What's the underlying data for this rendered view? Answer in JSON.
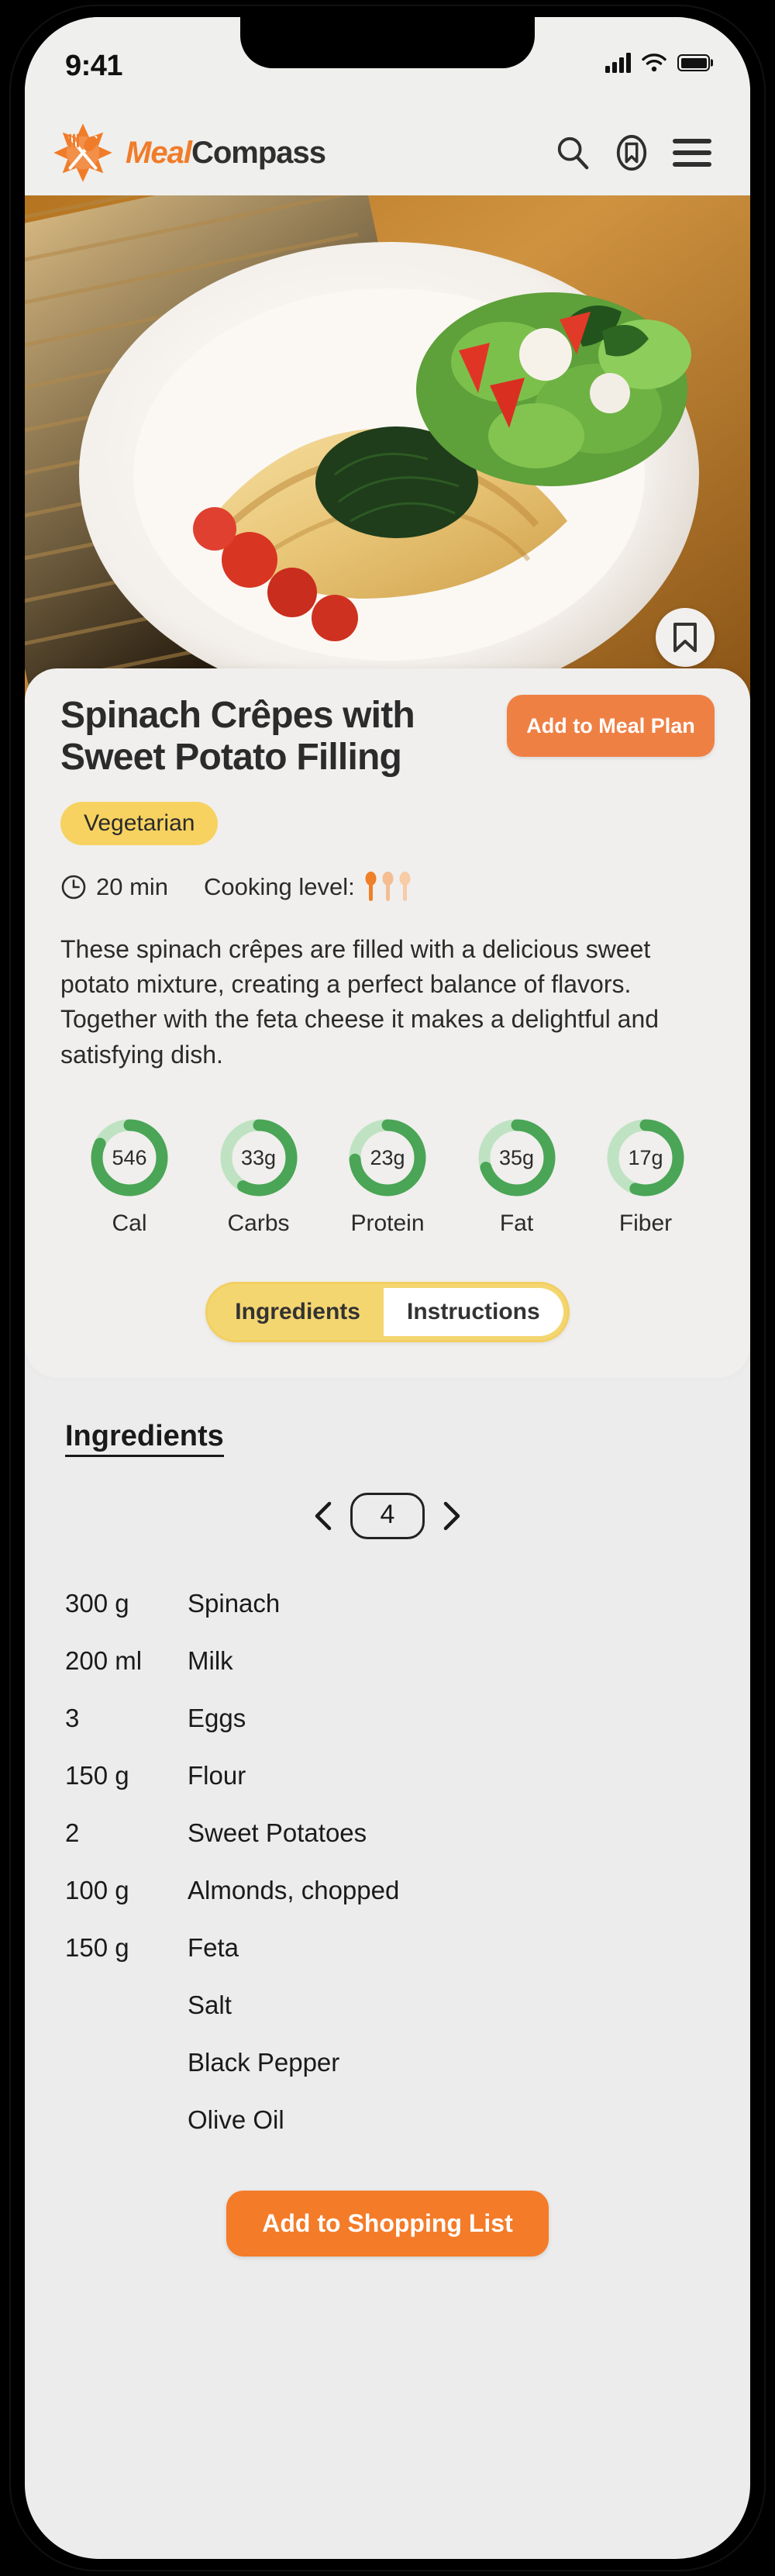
{
  "status_bar": {
    "time": "9:41",
    "signal_icon": "cellular-signal-icon",
    "wifi_icon": "wifi-icon",
    "battery_icon": "battery-full-icon"
  },
  "header": {
    "logo_icon": "meal-compass-logo-icon",
    "brand_part1": "Meal",
    "brand_part2": "Compass",
    "search_icon": "search-icon",
    "bookmark_icon": "bookmark-circle-icon",
    "menu_icon": "hamburger-menu-icon"
  },
  "hero": {
    "image_alt": "spinach crepes with salad on white plate",
    "bookmark_icon": "bookmark-icon"
  },
  "recipe": {
    "title": "Spinach Crêpes with Sweet Potato Filling",
    "add_to_meal_plan_label": "Add to Meal Plan",
    "diet_tag": "Vegetarian",
    "time_icon": "clock-icon",
    "time": "20 min",
    "cooking_level_label": "Cooking level:",
    "cooking_level_value": 1,
    "cooking_level_max": 3,
    "cooking_level_icon": "spoon-icon",
    "description": "These spinach crêpes are filled with a delicious sweet potato mixture, creating a perfect balance of flavors. Together with the feta cheese it makes a delightful and satisfying dish."
  },
  "nutrition": {
    "ring_color": "#4aa койка",
    "items": [
      {
        "value": "546",
        "label": "Cal",
        "percent": 82
      },
      {
        "value": "33g",
        "label": "Carbs",
        "percent": 58
      },
      {
        "value": "23g",
        "label": "Protein",
        "percent": 74
      },
      {
        "value": "35g",
        "label": "Fat",
        "percent": 70
      },
      {
        "value": "17g",
        "label": "Fiber",
        "percent": 55
      }
    ]
  },
  "tabs": {
    "items": [
      {
        "label": "Ingredients",
        "active": true
      },
      {
        "label": "Instructions",
        "active": false
      }
    ]
  },
  "ingredients_section": {
    "heading": "Ingredients",
    "servings": "4",
    "prev_icon": "chevron-left-icon",
    "next_icon": "chevron-right-icon",
    "rows": [
      {
        "qty": "300 g",
        "name": "Spinach"
      },
      {
        "qty": "200 ml",
        "name": "Milk"
      },
      {
        "qty": "3",
        "name": "Eggs"
      },
      {
        "qty": "150 g",
        "name": "Flour"
      },
      {
        "qty": "2",
        "name": "Sweet Potatoes"
      },
      {
        "qty": "100 g",
        "name": "Almonds, chopped"
      },
      {
        "qty": "150 g",
        "name": "Feta"
      },
      {
        "qty": "",
        "name": "Salt"
      },
      {
        "qty": "",
        "name": "Black Pepper"
      },
      {
        "qty": "",
        "name": "Olive Oil"
      }
    ],
    "add_to_shopping_list_label": "Add to Shopping List"
  },
  "colors": {
    "brand_orange": "#f07c2a",
    "button_orange": "#f47b28",
    "tag_yellow": "#f7d260",
    "ring_green": "#4aa556",
    "ring_track": "#bfe3c2"
  }
}
